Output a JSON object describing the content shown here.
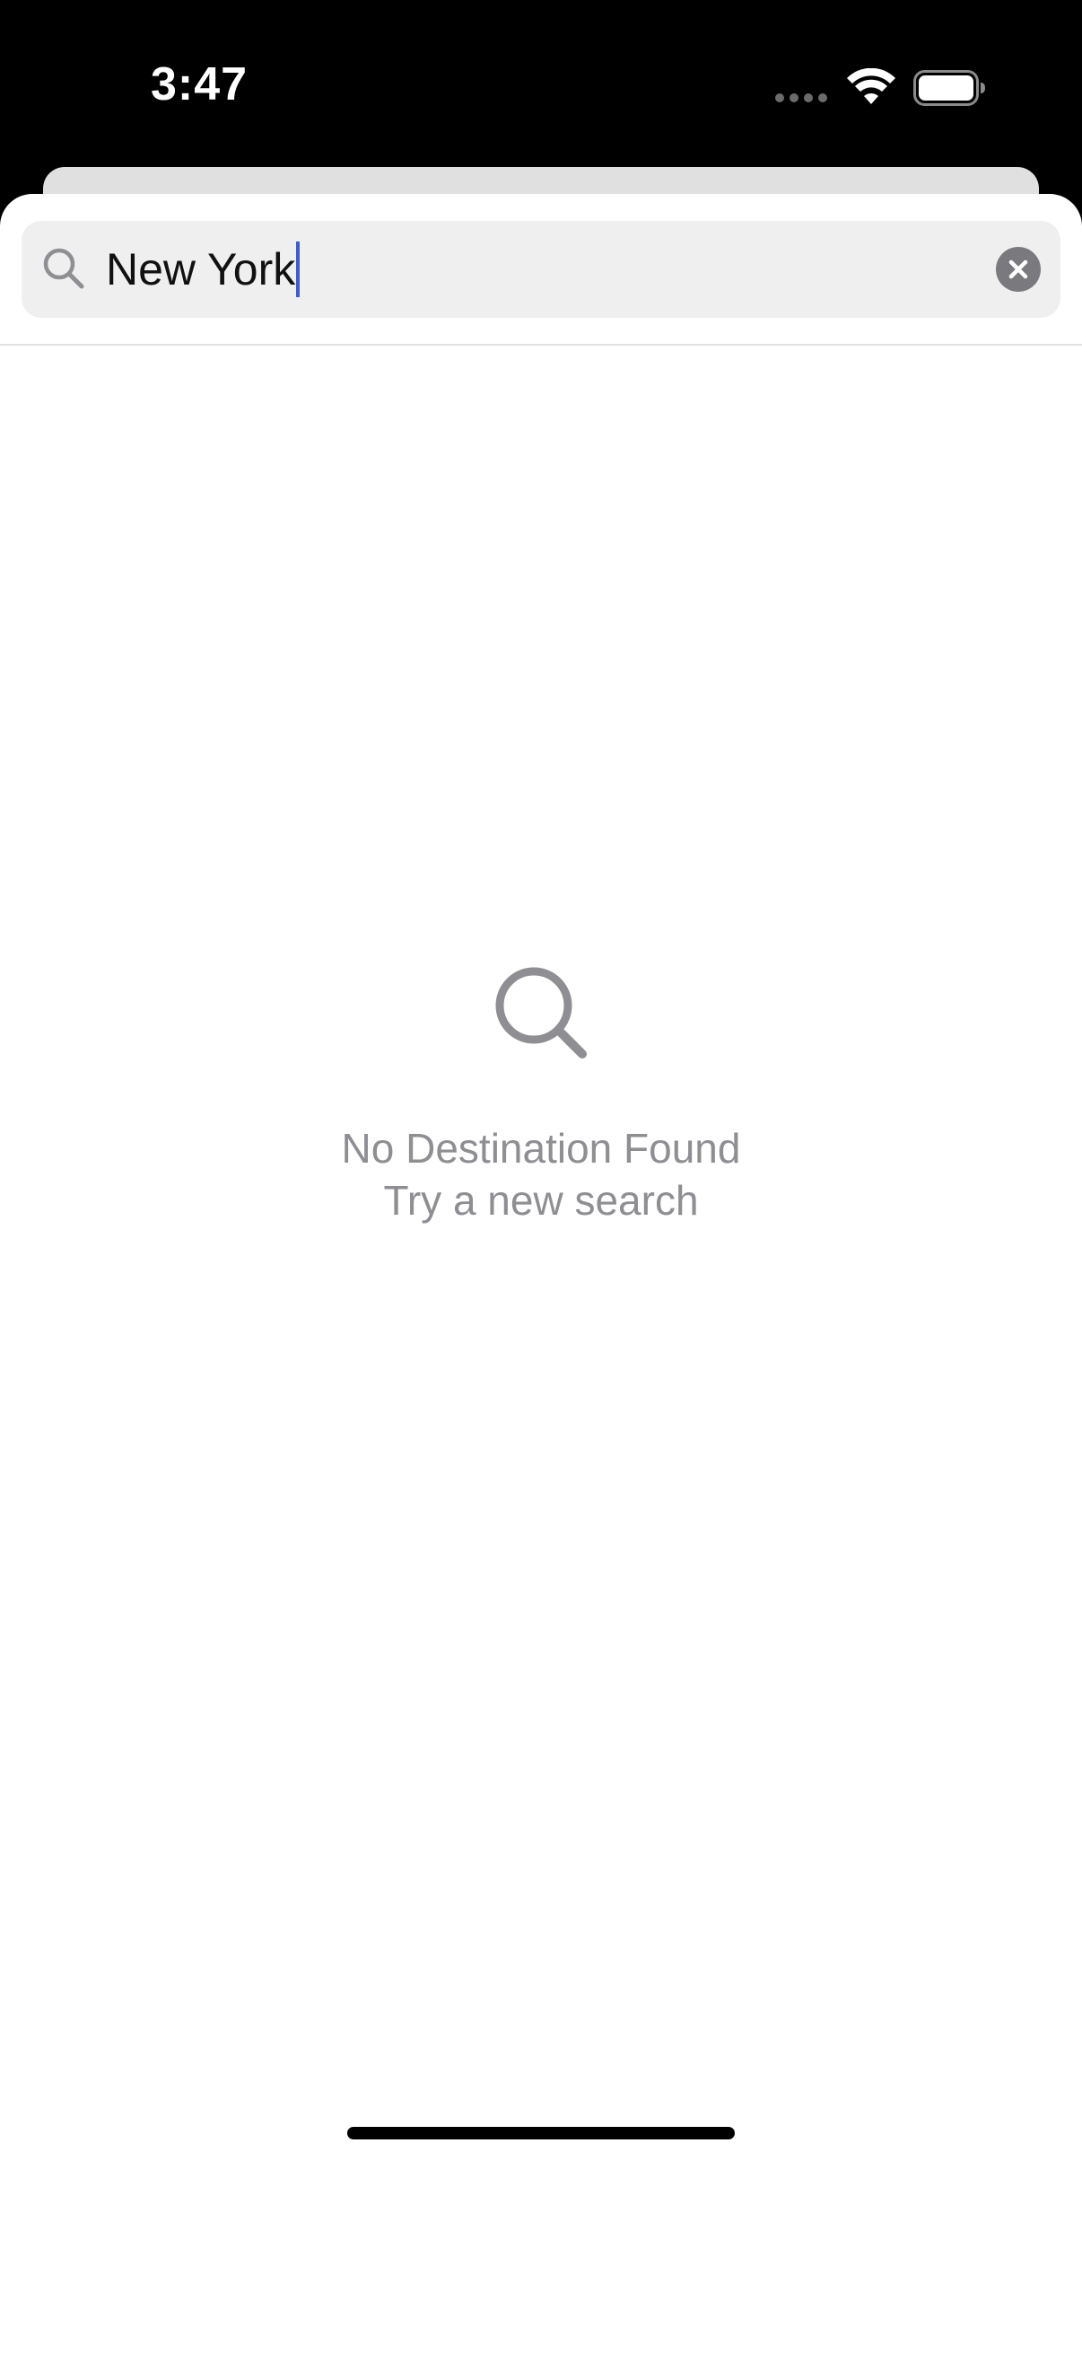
{
  "status_bar": {
    "time": "3:47"
  },
  "search": {
    "value": "New York",
    "icon": "search-icon",
    "clear_icon": "clear-icon"
  },
  "empty_state": {
    "icon": "search-icon",
    "title": "No Destination Found",
    "subtitle": "Try a new search"
  },
  "colors": {
    "caret": "#3b5ccc",
    "muted_text": "#8e8e93",
    "search_field_bg": "#efefef"
  }
}
